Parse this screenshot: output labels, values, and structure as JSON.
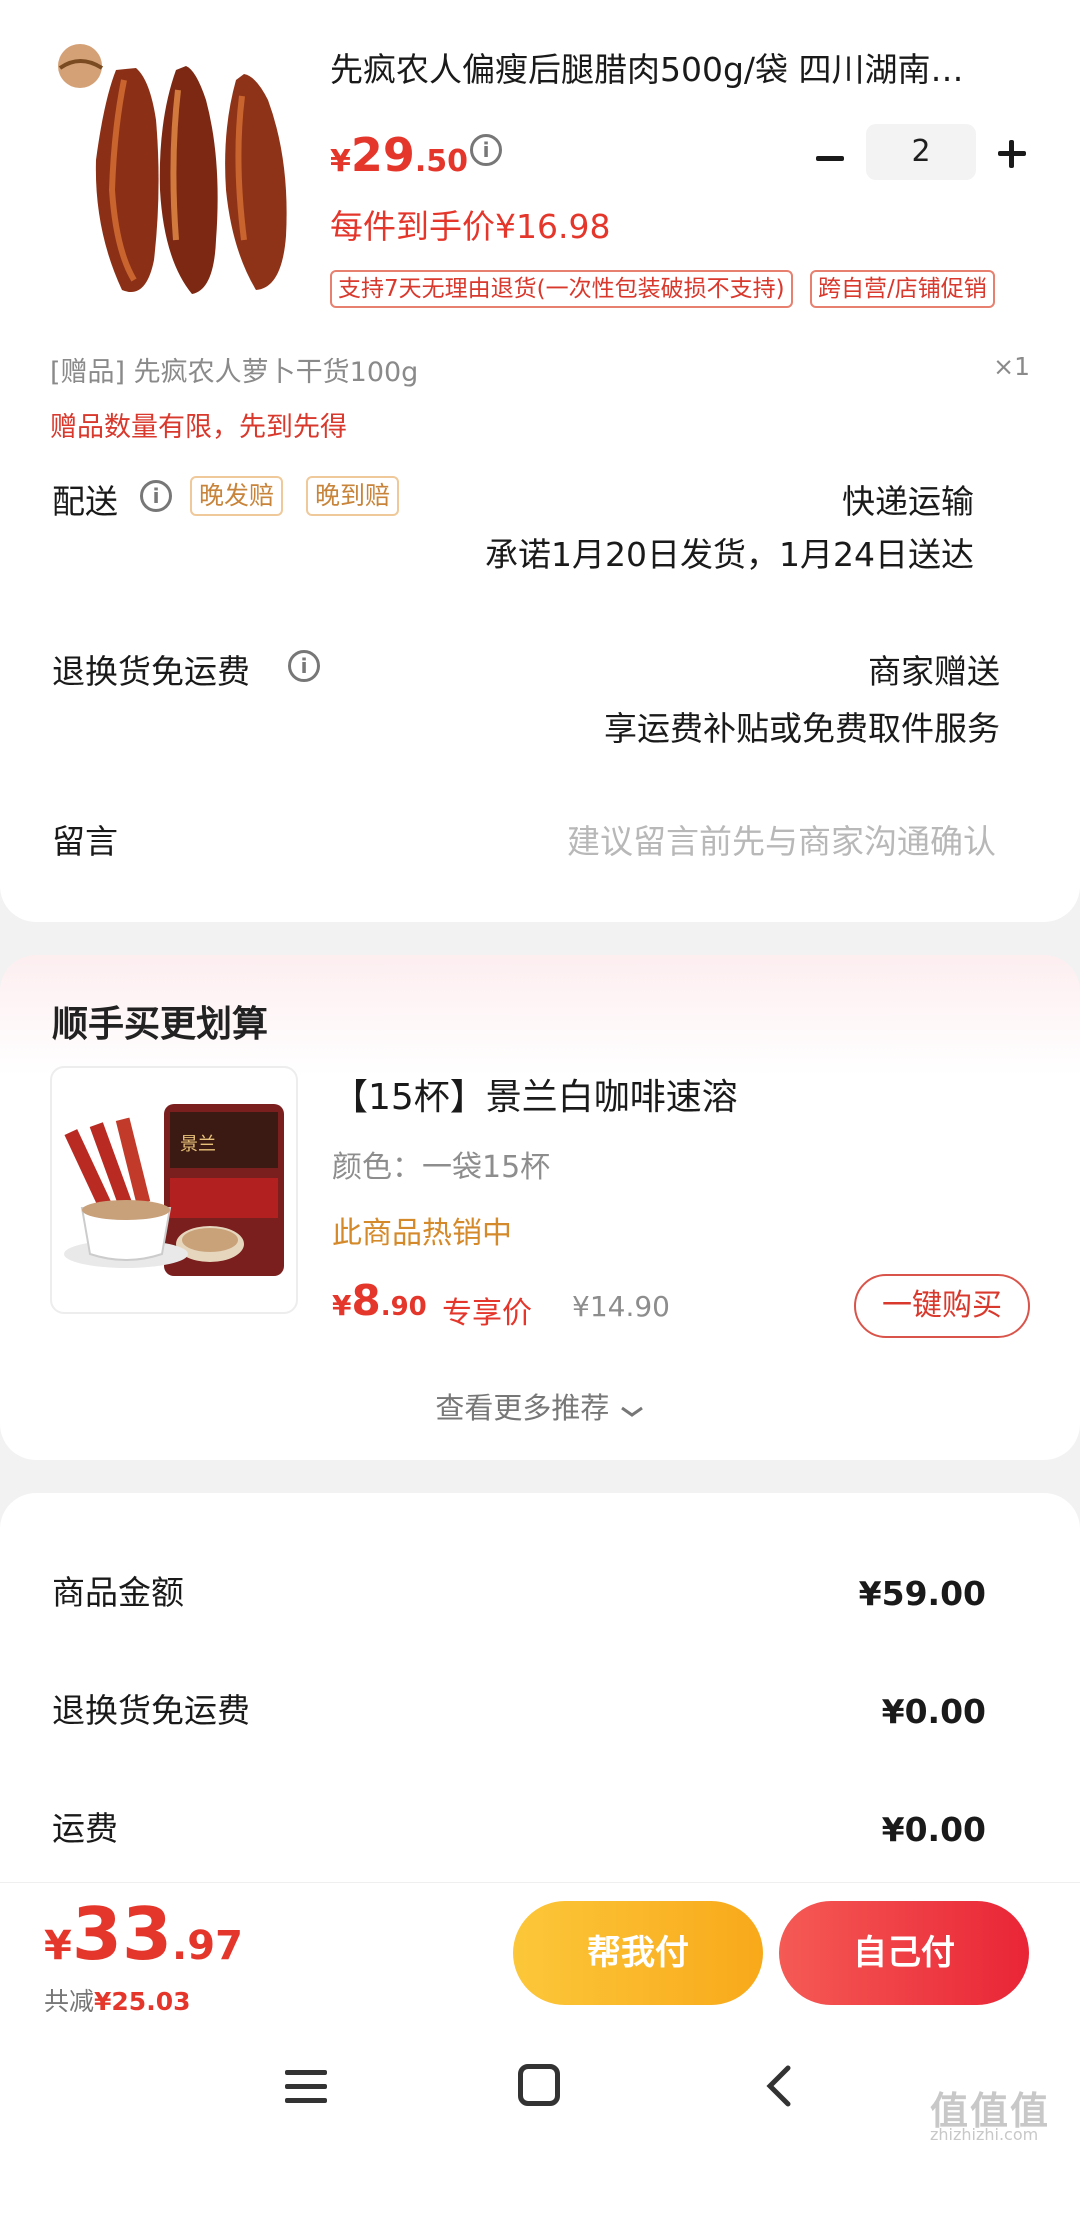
{
  "product": {
    "title": "先疯农人偏瘦后腿腊肉500g/袋 四川湖南…",
    "price_currency": "¥",
    "price_int": "29",
    "price_dec": ".50",
    "quantity": "2",
    "per_item_price": "每件到手价¥16.98",
    "tags": [
      "支持7天无理由退货(一次性包装破损不支持)",
      "跨自营/店铺促销"
    ]
  },
  "gift": {
    "label": "[赠品]   先疯农人萝卜干货100g",
    "qty": "×1",
    "note": "赠品数量有限，先到先得"
  },
  "delivery": {
    "label": "配送",
    "tags": [
      "晚发赔",
      "晚到赔"
    ],
    "method": "快递运输",
    "promise": "承诺1月20日发货，1月24日送达"
  },
  "return_shipping": {
    "label": "退换货免运费",
    "value": "商家赠送",
    "desc": "享运费补贴或免费取件服务"
  },
  "message": {
    "label": "留言",
    "placeholder": "建议留言前先与商家沟通确认"
  },
  "upsell": {
    "title": "顺手买更划算",
    "item_name": "【15杯】景兰白咖啡速溶",
    "item_color": "颜色：一袋15杯",
    "hot": "此商品热销中",
    "price_currency": "¥",
    "price_int": "8",
    "price_dec": ".90",
    "exclusive": "专享价",
    "original_price": "¥14.90",
    "buy_button": "一键购买",
    "more": "查看更多推荐"
  },
  "summary": {
    "rows": [
      {
        "label": "商品金额",
        "value": "¥59.00"
      },
      {
        "label": "退换货免运费",
        "value": "¥0.00"
      },
      {
        "label": "运费",
        "value": "¥0.00"
      }
    ]
  },
  "bottom": {
    "total_currency": "¥",
    "total_int": "33",
    "total_dec": ".97",
    "saved_prefix": "共减",
    "saved_value": "¥25.03",
    "help_pay": "帮我付",
    "self_pay": "自己付"
  },
  "watermark": {
    "text": "值值值",
    "sub": "zhizhizhi.com"
  },
  "colors": {
    "accent_red": "#e4362b",
    "help_yellow": "#fcc73a",
    "pay_red": "#e92536",
    "hot_orange": "#d48a2b"
  }
}
